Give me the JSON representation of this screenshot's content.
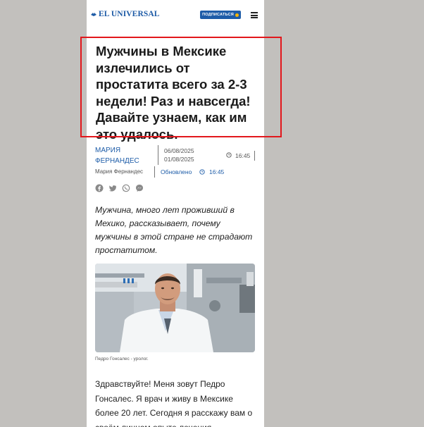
{
  "header": {
    "logo_text": "EL UNIVERSAL",
    "subscribe_label": "ПОДПИСАТЬСЯ"
  },
  "article": {
    "headline": "Мужчины в Мексике излечились от простатита всего за 2-3 недели! Раз и навсегда! Давайте узнаем, как им это удалось.",
    "author": "МАРИЯ ФЕРНАНДЕС",
    "date_published": "06/08/2025",
    "date_original": "01/08/2025",
    "time": "16:45",
    "author_small": "Мария Фернандес",
    "updated_label": "Обновлено",
    "updated_time": "16:45",
    "lead": "Мужчина, много лет проживший в Мехико, рассказывает, почему мужчины в этой стране не страдают простатитом.",
    "photo_caption": "Педро Гонсалес - уролог.",
    "body": "Здравствуйте! Меня зовут Педро Гонсалес. Я врач и живу в Мексике более 20 лет. Сегодня я расскажу вам о своём личном опыте лечения"
  },
  "social_icons": [
    "facebook-icon",
    "twitter-icon",
    "whatsapp-icon",
    "messenger-icon"
  ],
  "colors": {
    "brand_blue": "#1d5ca8",
    "highlight_red": "#e2171c",
    "backdrop": "#c2c0bd"
  }
}
